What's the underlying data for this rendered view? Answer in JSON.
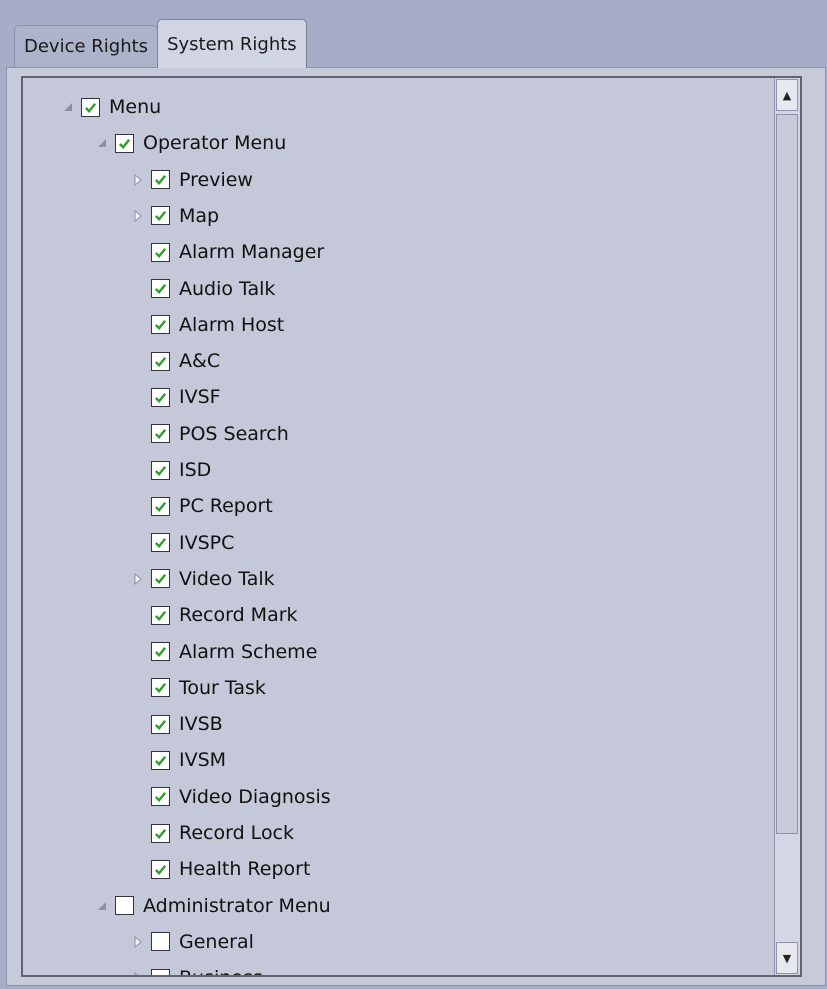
{
  "tabs": [
    {
      "label": "Device Rights",
      "active": false
    },
    {
      "label": "System Rights",
      "active": true
    }
  ],
  "icons": {
    "checked": "check-icon",
    "expanded": "triangle-down-icon",
    "collapsed": "triangle-right-icon"
  },
  "colors": {
    "check": "#2e9e2a",
    "panel": "#c4c8d8",
    "background": "#a7adc6"
  },
  "tree": [
    {
      "label": "Menu",
      "level": 0,
      "expander": "expanded",
      "checked": true
    },
    {
      "label": "Operator Menu",
      "level": 1,
      "expander": "expanded",
      "checked": true
    },
    {
      "label": "Preview",
      "level": 2,
      "expander": "collapsed",
      "checked": true
    },
    {
      "label": "Map",
      "level": 2,
      "expander": "collapsed",
      "checked": true
    },
    {
      "label": "Alarm Manager",
      "level": 2,
      "expander": "none",
      "checked": true
    },
    {
      "label": "Audio Talk",
      "level": 2,
      "expander": "none",
      "checked": true
    },
    {
      "label": "Alarm Host",
      "level": 2,
      "expander": "none",
      "checked": true
    },
    {
      "label": "A&C",
      "level": 2,
      "expander": "none",
      "checked": true
    },
    {
      "label": "IVSF",
      "level": 2,
      "expander": "none",
      "checked": true
    },
    {
      "label": "POS Search",
      "level": 2,
      "expander": "none",
      "checked": true
    },
    {
      "label": "ISD",
      "level": 2,
      "expander": "none",
      "checked": true
    },
    {
      "label": "PC Report",
      "level": 2,
      "expander": "none",
      "checked": true
    },
    {
      "label": "IVSPC",
      "level": 2,
      "expander": "none",
      "checked": true
    },
    {
      "label": "Video Talk",
      "level": 2,
      "expander": "collapsed",
      "checked": true
    },
    {
      "label": "Record Mark",
      "level": 2,
      "expander": "none",
      "checked": true
    },
    {
      "label": "Alarm Scheme",
      "level": 2,
      "expander": "none",
      "checked": true
    },
    {
      "label": "Tour Task",
      "level": 2,
      "expander": "none",
      "checked": true
    },
    {
      "label": "IVSB",
      "level": 2,
      "expander": "none",
      "checked": true
    },
    {
      "label": "IVSM",
      "level": 2,
      "expander": "none",
      "checked": true
    },
    {
      "label": "Video Diagnosis",
      "level": 2,
      "expander": "none",
      "checked": true
    },
    {
      "label": "Record Lock",
      "level": 2,
      "expander": "none",
      "checked": true
    },
    {
      "label": "Health Report",
      "level": 2,
      "expander": "none",
      "checked": true
    },
    {
      "label": "Administrator Menu",
      "level": 1,
      "expander": "expanded",
      "checked": false
    },
    {
      "label": "General",
      "level": 2,
      "expander": "collapsed",
      "checked": false
    },
    {
      "label": "Business",
      "level": 2,
      "expander": "collapsed",
      "checked": false
    }
  ]
}
